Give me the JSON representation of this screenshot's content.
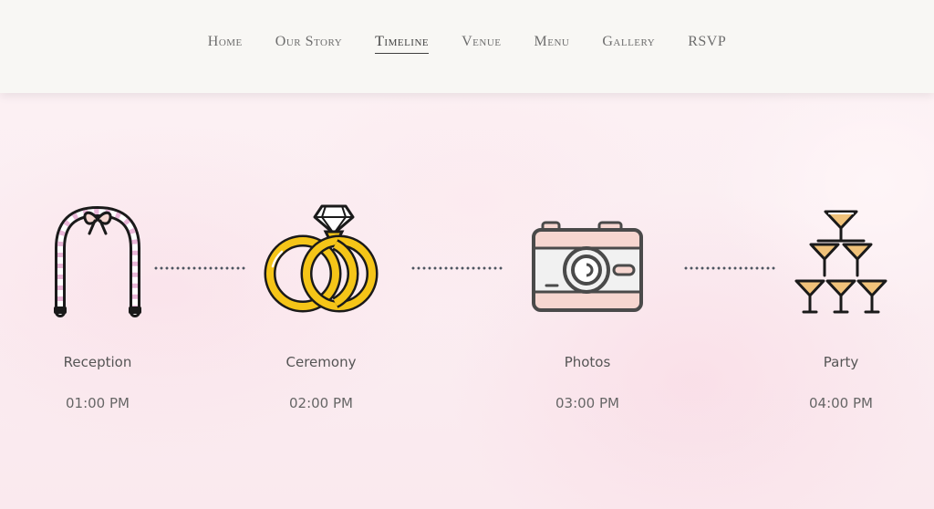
{
  "nav": {
    "items": [
      {
        "label": "Home",
        "active": false
      },
      {
        "label": "Our Story",
        "active": false
      },
      {
        "label": "Timeline",
        "active": true
      },
      {
        "label": "Venue",
        "active": false
      },
      {
        "label": "Menu",
        "active": false
      },
      {
        "label": "Gallery",
        "active": false
      },
      {
        "label": "RSVP",
        "active": false
      }
    ]
  },
  "timeline": {
    "events": [
      {
        "label": "Reception",
        "time": "01:00 PM",
        "icon": "wedding-arch-icon"
      },
      {
        "label": "Ceremony",
        "time": "02:00 PM",
        "icon": "wedding-rings-icon"
      },
      {
        "label": "Photos",
        "time": "03:00 PM",
        "icon": "camera-icon"
      },
      {
        "label": "Party",
        "time": "04:00 PM",
        "icon": "champagne-tower-icon"
      }
    ]
  },
  "colors": {
    "nav_bg": "#f8f7f4",
    "nav_text": "#6d6d6d",
    "nav_active": "#3f3f3f",
    "gold": "#f5c518",
    "blush": "#f6d6d0",
    "outline": "#1a1a1a",
    "dots": "#4d5560"
  }
}
